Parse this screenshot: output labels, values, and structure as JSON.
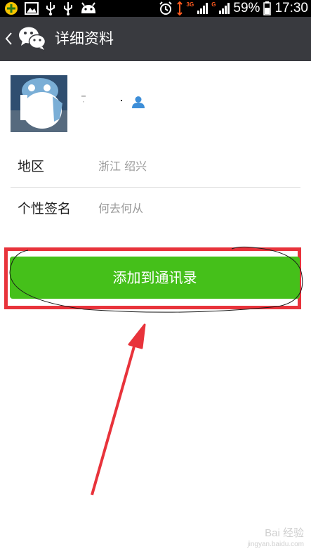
{
  "status_bar": {
    "network_3g": "3G",
    "network_g": "G",
    "battery": "59%",
    "time": "17:30",
    "icons": [
      "notification-icon",
      "image-icon",
      "usb-icon",
      "usb-icon",
      "android-icon",
      "alarm-icon",
      "data-transfer-icon",
      "signal-icon",
      "battery-icon"
    ]
  },
  "header": {
    "title": "详细资料",
    "icons": [
      "back-icon",
      "wechat-logo-icon"
    ]
  },
  "profile": {
    "icons": [
      "avatar",
      "contact-icon"
    ]
  },
  "details": [
    {
      "label": "地区",
      "value": "浙江  绍兴"
    },
    {
      "label": "个性签名",
      "value": "何去何从"
    }
  ],
  "actions": {
    "add_contact_label": "添加到通讯录"
  },
  "colors": {
    "titlebar": "#393a3f",
    "primary_button": "#45c01a",
    "highlight": "#e8333b",
    "secondary_text": "#9a9a9a"
  },
  "watermark": {
    "text": "Bai 经验",
    "subtext": "jingyan.baidu.com"
  }
}
